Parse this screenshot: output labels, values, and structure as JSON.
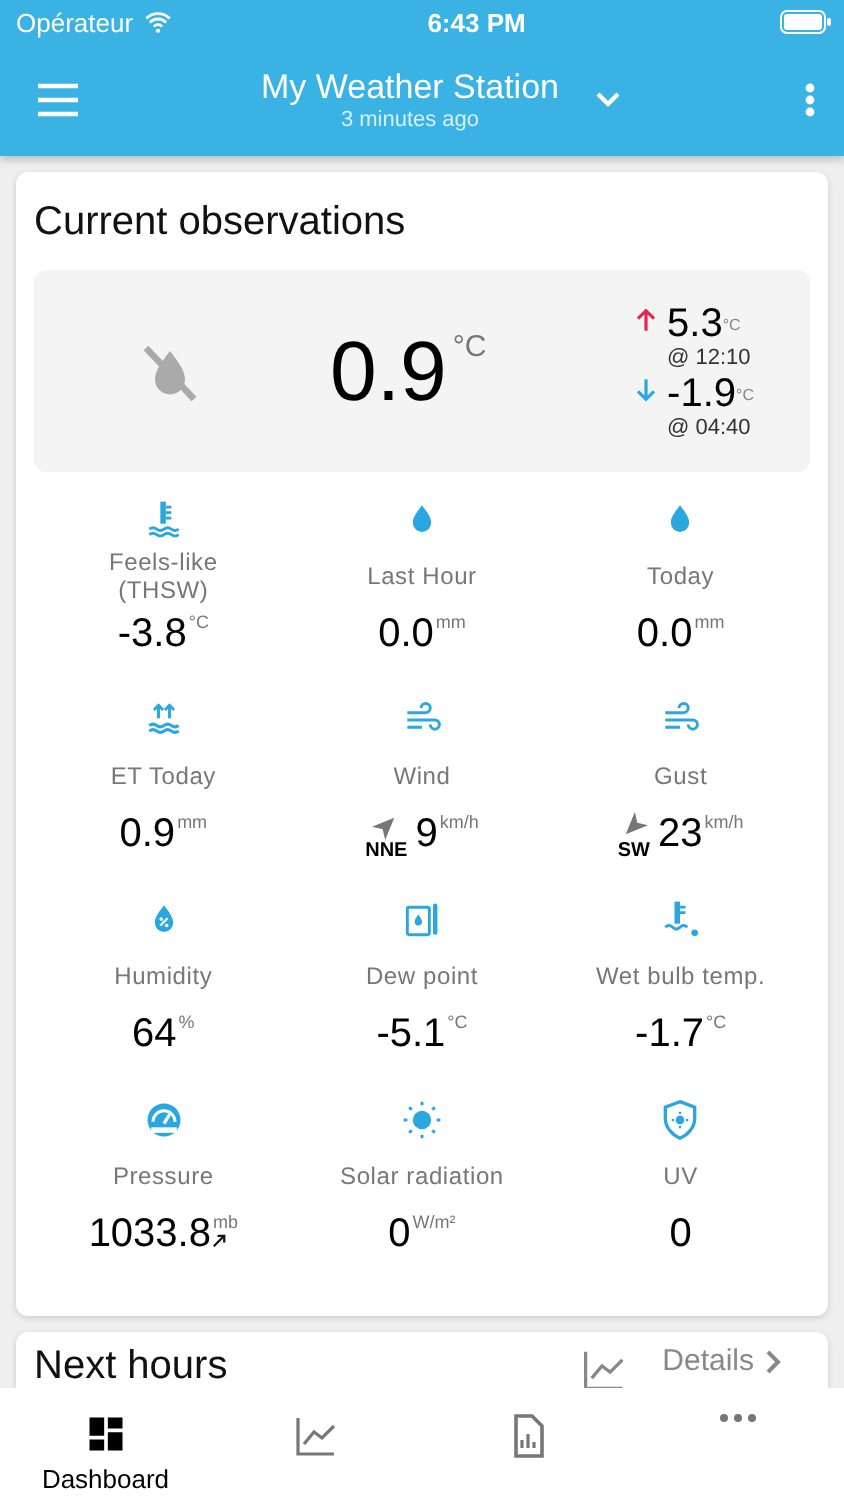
{
  "status_bar": {
    "carrier": "Opérateur",
    "time": "6:43 PM"
  },
  "header": {
    "title": "My Weather Station",
    "subtitle": "3 minutes ago"
  },
  "current": {
    "title": "Current observations",
    "temperature": "0.9",
    "unit": "°C",
    "high": {
      "value": "5.3",
      "unit": "°C",
      "time": "@ 12:10"
    },
    "low": {
      "value": "-1.9",
      "unit": "°C",
      "time": "@ 04:40"
    },
    "metrics": [
      {
        "kind": "plain",
        "label": "Feels-like (THSW)",
        "value": "-3.8",
        "unit": "°C"
      },
      {
        "kind": "plain",
        "label": "Last Hour",
        "value": "0.0",
        "unit": "mm"
      },
      {
        "kind": "plain",
        "label": "Today",
        "value": "0.0",
        "unit": "mm"
      },
      {
        "kind": "plain",
        "label": "ET Today",
        "value": "0.9",
        "unit": "mm"
      },
      {
        "kind": "wind",
        "label": "Wind",
        "value": "9",
        "unit": "km/h",
        "direction": "NNE"
      },
      {
        "kind": "wind",
        "label": "Gust",
        "value": "23",
        "unit": "km/h",
        "direction": "SW"
      },
      {
        "kind": "plain",
        "label": "Humidity",
        "value": "64",
        "unit": "%"
      },
      {
        "kind": "plain",
        "label": "Dew point",
        "value": "-5.1",
        "unit": "°C"
      },
      {
        "kind": "plain",
        "label": "Wet bulb temp.",
        "value": "-1.7",
        "unit": "°C"
      },
      {
        "kind": "trend",
        "label": "Pressure",
        "value": "1033.8",
        "unit": "mb"
      },
      {
        "kind": "plain",
        "label": "Solar radiation",
        "value": "0",
        "unit": "W/m²"
      },
      {
        "kind": "plain",
        "label": "UV",
        "value": "0"
      }
    ]
  },
  "next_hours": {
    "title": "Next hours",
    "details": "Details"
  },
  "tabs": [
    {
      "label": "Dashboard",
      "selected": true
    },
    {
      "selected": false
    },
    {
      "selected": false
    },
    {
      "selected": false
    }
  ]
}
